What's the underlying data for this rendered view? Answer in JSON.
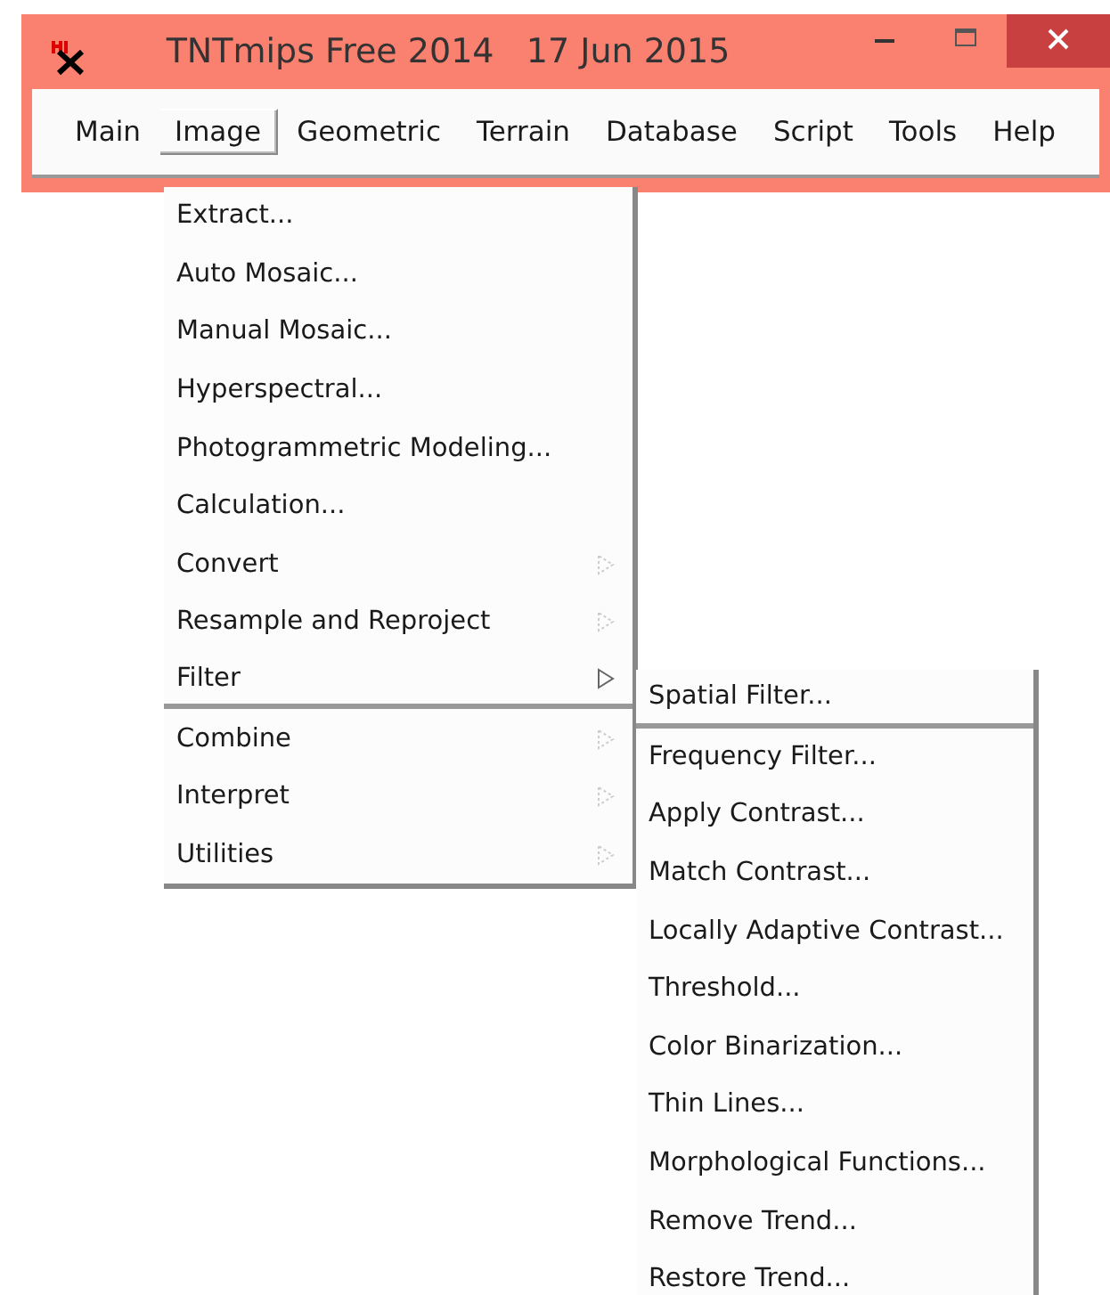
{
  "window": {
    "title": "TNTmips Free 2014   17 Jun 2015"
  },
  "menubar": [
    {
      "label": "Main",
      "selected": false
    },
    {
      "label": "Image",
      "selected": true
    },
    {
      "label": "Geometric",
      "selected": false
    },
    {
      "label": "Terrain",
      "selected": false
    },
    {
      "label": "Database",
      "selected": false
    },
    {
      "label": "Script",
      "selected": false
    },
    {
      "label": "Tools",
      "selected": false
    },
    {
      "label": "Help",
      "selected": false
    }
  ],
  "image_menu": [
    {
      "label": "Extract...",
      "kind": "command",
      "selected": false
    },
    {
      "label": "Auto Mosaic...",
      "kind": "command",
      "selected": false
    },
    {
      "label": "Manual Mosaic...",
      "kind": "command",
      "selected": false
    },
    {
      "label": "Hyperspectral...",
      "kind": "command",
      "selected": false
    },
    {
      "label": "Photogrammetric Modeling...",
      "kind": "command",
      "selected": false
    },
    {
      "label": "Calculation...",
      "kind": "command",
      "selected": false
    },
    {
      "label": "Convert",
      "kind": "submenu",
      "selected": false
    },
    {
      "label": "Resample and Reproject",
      "kind": "submenu",
      "selected": false
    },
    {
      "label": "Filter",
      "kind": "submenu",
      "selected": true
    },
    {
      "label": "Combine",
      "kind": "submenu",
      "selected": false
    },
    {
      "label": "Interpret",
      "kind": "submenu",
      "selected": false
    },
    {
      "label": "Utilities",
      "kind": "submenu",
      "selected": false
    }
  ],
  "filter_menu": [
    {
      "label": "Spatial Filter...",
      "selected": true
    },
    {
      "label": "Frequency Filter...",
      "selected": false
    },
    {
      "label": "Apply Contrast...",
      "selected": false
    },
    {
      "label": "Match Contrast...",
      "selected": false
    },
    {
      "label": "Locally Adaptive Contrast...",
      "selected": false
    },
    {
      "label": "Threshold...",
      "selected": false
    },
    {
      "label": "Color Binarization...",
      "selected": false
    },
    {
      "label": "Thin Lines...",
      "selected": false
    },
    {
      "label": "Morphological Functions...",
      "selected": false
    },
    {
      "label": "Remove Trend...",
      "selected": false
    },
    {
      "label": "Restore Trend...",
      "selected": false
    }
  ]
}
